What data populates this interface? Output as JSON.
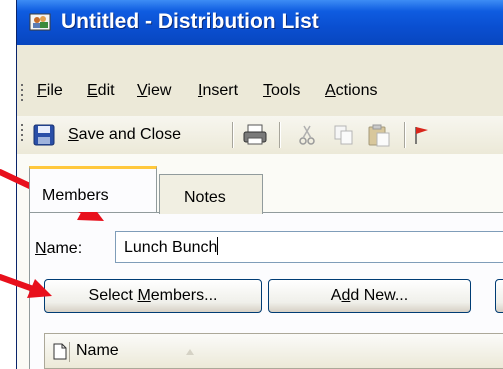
{
  "window": {
    "title": "Untitled - Distribution List"
  },
  "menu": {
    "items": [
      "File",
      "Edit",
      "View",
      "Insert",
      "Tools",
      "Actions"
    ]
  },
  "toolbar": {
    "save_label": "Save and Close"
  },
  "tabs": [
    {
      "label": "Members",
      "active": true
    },
    {
      "label": "Notes",
      "active": false
    }
  ],
  "form": {
    "name_label": "Name:",
    "name_value": "Lunch Bunch"
  },
  "buttons": {
    "select_members": "Select Members...",
    "add_new": "Add New..."
  },
  "list": {
    "column_name": "Name"
  },
  "colors": {
    "titlebar": "#0a4fd1",
    "annotation_arrow": "#e8101c",
    "active_tab_accent": "#ffc83c"
  }
}
